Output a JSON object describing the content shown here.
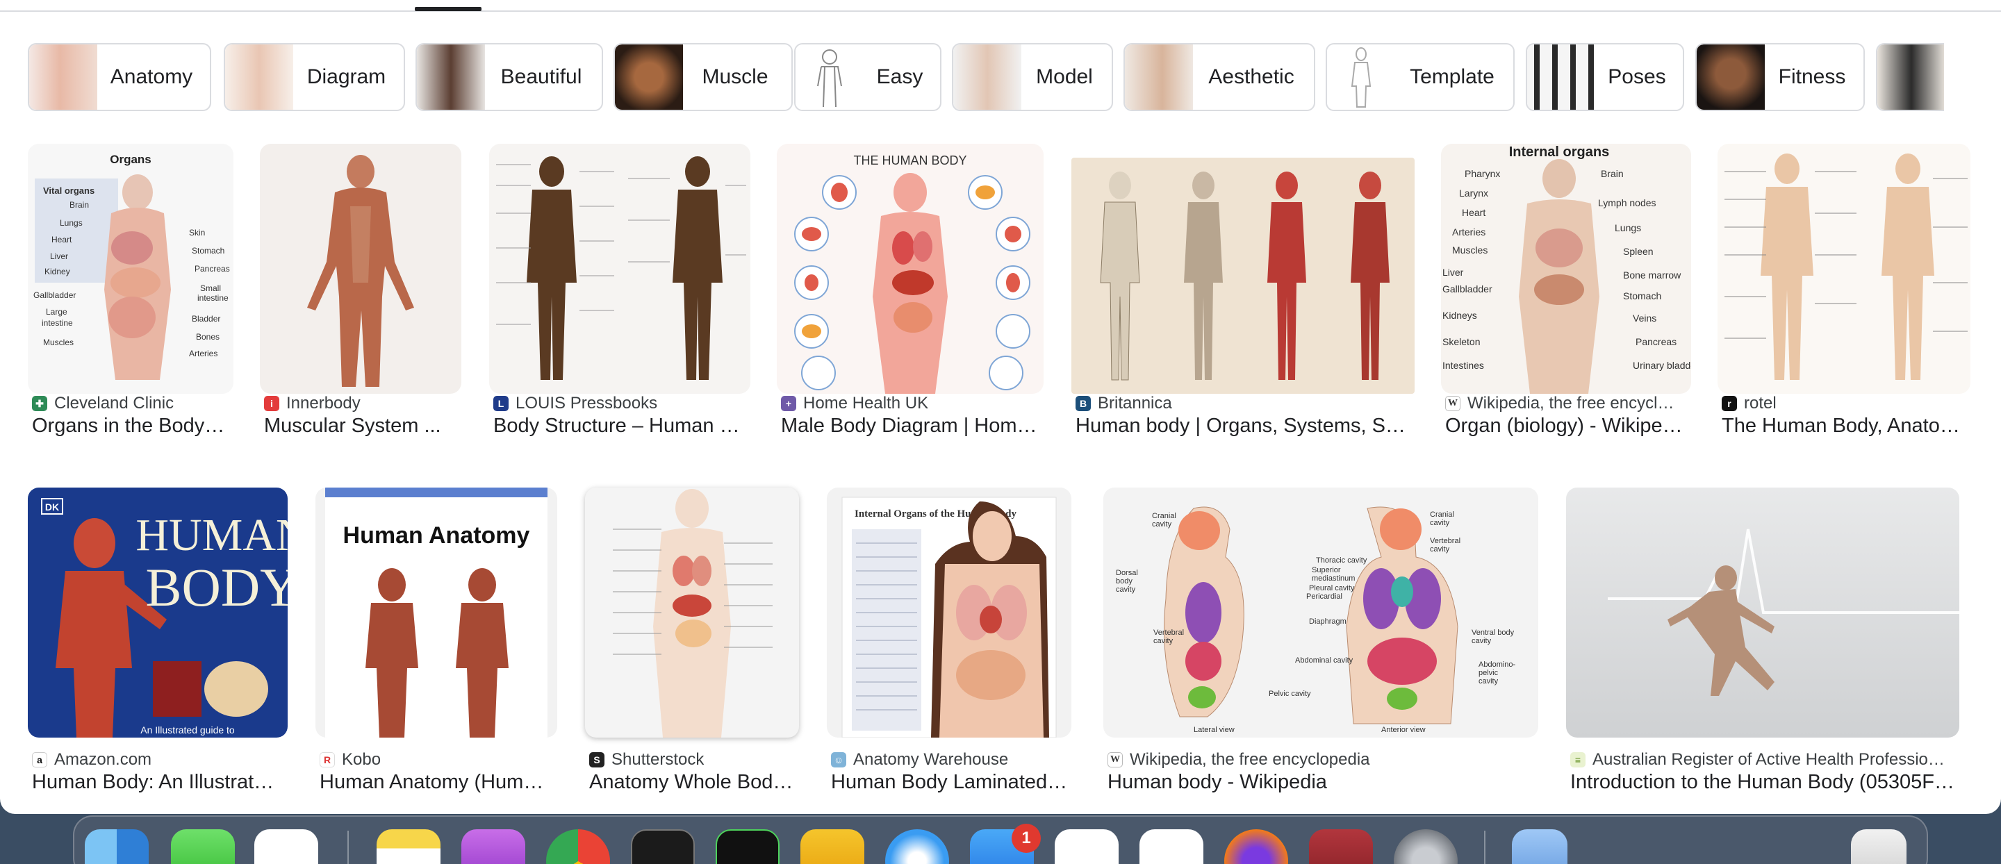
{
  "chips": [
    {
      "label": "Anatomy",
      "thumb": "organ-diagram-thumb"
    },
    {
      "label": "Diagram",
      "thumb": "body-diagram-thumb"
    },
    {
      "label": "Beautiful",
      "thumb": "model-photo-thumb"
    },
    {
      "label": "Muscle",
      "thumb": "muscular-torso-thumb"
    },
    {
      "label": "Easy",
      "thumb": "outline-figure-thumb"
    },
    {
      "label": "Model",
      "thumb": "body-model-thumb"
    },
    {
      "label": "Aesthetic",
      "thumb": "aesthetic-photo-thumb"
    },
    {
      "label": "Template",
      "thumb": "outline-template-thumb"
    },
    {
      "label": "Poses",
      "thumb": "poses-thumb"
    },
    {
      "label": "Fitness",
      "thumb": "fitness-thumb"
    }
  ],
  "results_row1": [
    {
      "source": "Cleveland Clinic",
      "title": "Organs in the Body…",
      "favicon": "cleveland-clinic-icon"
    },
    {
      "source": "Innerbody",
      "title": "Muscular System ...",
      "favicon": "innerbody-icon"
    },
    {
      "source": "LOUIS Pressbooks",
      "title": "Body Structure – Human …",
      "favicon": "louis-pressbooks-icon"
    },
    {
      "source": "Home Health UK",
      "title": "Male Body Diagram | Hom…",
      "favicon": "home-health-icon"
    },
    {
      "source": "Britannica",
      "title": "Human body | Organs, Systems, S…",
      "favicon": "britannica-icon"
    },
    {
      "source": "Wikipedia, the free encycl…",
      "title": "Organ (biology) - Wikipe…",
      "favicon": "wikipedia-icon"
    },
    {
      "source": "rotel",
      "title": "The Human Body, Anato…",
      "favicon": "rotel-icon"
    }
  ],
  "results_row2": [
    {
      "source": "Amazon.com",
      "title": "Human Body: An Illustrat…",
      "favicon": "amazon-icon"
    },
    {
      "source": "Kobo",
      "title": "Human Anatomy (Hum…",
      "favicon": "kobo-icon"
    },
    {
      "source": "Shutterstock",
      "title": "Anatomy Whole Bod…",
      "favicon": "shutterstock-icon"
    },
    {
      "source": "Anatomy Warehouse",
      "title": "Human Body Laminated…",
      "favicon": "anatomy-warehouse-icon"
    },
    {
      "source": "Wikipedia, the free encyclopedia",
      "title": "Human body - Wikipedia",
      "favicon": "wikipedia-icon"
    },
    {
      "source": "Australian Register of Active Health Professio…",
      "title": "Introduction to the Human Body (05305F…",
      "favicon": "arahp-icon"
    }
  ],
  "image_text": {
    "organs_heading": "Organs",
    "vital_organs": "Vital organs",
    "organ_labels_left": [
      "Brain",
      "Lungs",
      "Heart",
      "Liver",
      "Kidney",
      "Gallbladder",
      "Large intestine",
      "Muscles"
    ],
    "organ_labels_right": [
      "Skin",
      "Stomach",
      "Pancreas",
      "Small intestine",
      "Bladder",
      "Bones",
      "Arteries"
    ],
    "human_body_title": "THE HUMAN BODY",
    "internal_organs_title": "Internal organs",
    "internal_labels_left": [
      "Pharynx",
      "Larynx",
      "Heart",
      "Arteries",
      "Muscles",
      "Liver",
      "Gallbladder",
      "Kidneys",
      "Skeleton",
      "Intestines"
    ],
    "internal_labels_right": [
      "Brain",
      "Lymph nodes",
      "Lungs",
      "Spleen",
      "Bone marrow",
      "Stomach",
      "Veins",
      "Pancreas",
      "Urinary bladder"
    ],
    "dk_logo": "DK",
    "book_title_line1": "HUMAN",
    "book_title_line2": "BODY",
    "book_subtitle": "An Illustrated guide to",
    "anatomy_cover_title": "Human Anatomy",
    "internal_organs_poster": "Internal Organs of the Human Body",
    "cavity_left": [
      "Cranial cavity",
      "Dorsal body cavity",
      "Vertebral cavity"
    ],
    "cavity_right": [
      "Cranial cavity",
      "Vertebral cavity",
      "Ventral body cavity",
      "Abdomino-pelvic cavity"
    ],
    "cavity_center": [
      "Thoracic cavity",
      "Superior mediastinum",
      "Pleural cavity",
      "Pericardial cavity",
      "Diaphragm",
      "Abdominal cavity",
      "Pelvic cavity"
    ],
    "view_labels": [
      "Lateral view",
      "Anterior view"
    ]
  },
  "dock": {
    "mail_badge": "1",
    "icons": [
      "finder-icon",
      "messages-icon",
      "freeform-icon",
      "notes-icon",
      "podcasts-icon",
      "chrome-icon",
      "terminal-icon",
      "terminal-dollar-icon",
      "vectorworks-icon",
      "safari-icon",
      "mail-icon",
      "preview-icon",
      "vscode-icon",
      "firefox-icon",
      "dictionary-icon",
      "system-settings-icon",
      "files-icon",
      "trash-icon"
    ]
  },
  "colors": {
    "accent": "#202124",
    "chip_border": "#dadce0",
    "dock": "#505c6e",
    "badge": "#e0392f"
  }
}
